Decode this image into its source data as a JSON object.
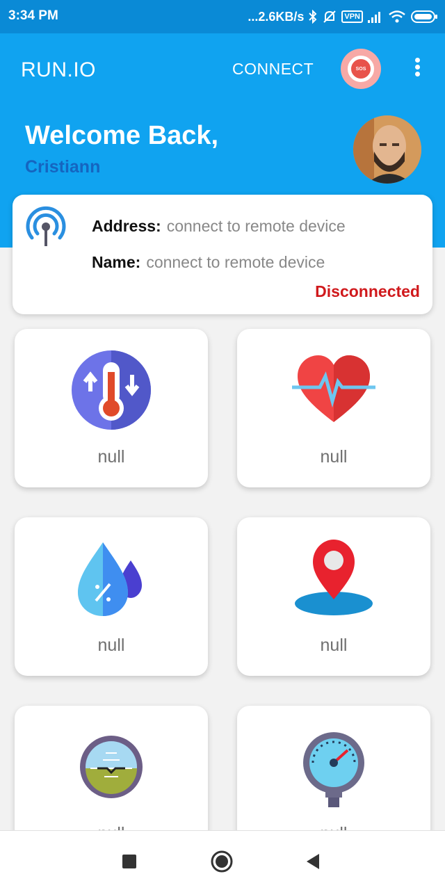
{
  "status_bar": {
    "time": "3:34 PM",
    "net_speed": "...2.6KB/s",
    "vpn_badge": "VPN",
    "icons": [
      "bluetooth-icon",
      "mute-bell-icon",
      "vpn-icon",
      "signal-icon",
      "wifi-icon",
      "battery-icon"
    ]
  },
  "app_bar": {
    "title": "RUN.IO",
    "connect_label": "CONNECT",
    "sos_label": "SOS"
  },
  "header": {
    "welcome": "Welcome Back,",
    "username": "Cristiann"
  },
  "device": {
    "address_label": "Address:",
    "address_value": "connect to remote device",
    "name_label": "Name:",
    "name_value": "connect to remote device",
    "status": "Disconnected"
  },
  "tiles": [
    {
      "icon": "temperature-icon",
      "value": "null"
    },
    {
      "icon": "heart-rate-icon",
      "value": "null"
    },
    {
      "icon": "humidity-icon",
      "value": "null"
    },
    {
      "icon": "location-icon",
      "value": "null"
    },
    {
      "icon": "attitude-indicator-icon",
      "value": "null"
    },
    {
      "icon": "pressure-gauge-icon",
      "value": "null"
    }
  ],
  "colors": {
    "status_bar": "#0a8ad6",
    "app_bar": "#10a3f0",
    "username": "#1565c0",
    "disconnected": "#d0191c"
  }
}
